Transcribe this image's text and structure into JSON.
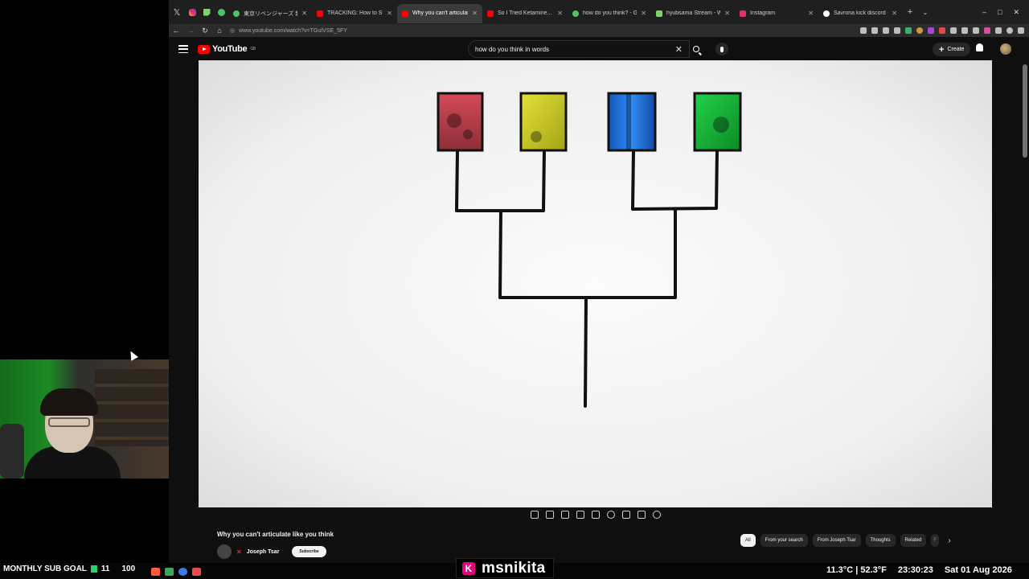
{
  "browser": {
    "tabs": [
      {
        "title": "東京リベンジャーズ 新衣装 ...",
        "color": "#4fc36a"
      },
      {
        "title": "TRACKING: How to Stick an I",
        "color": "#ff0000"
      },
      {
        "title": "Why you can't articulate like",
        "color": "#ff0000",
        "active": true
      },
      {
        "title": "So I Tried Ketamine... | Bryan",
        "color": "#ff0000"
      },
      {
        "title": "how do you think? - Google",
        "color": "#4fc36a"
      },
      {
        "title": "hyubsama Stream - Watch Li",
        "color": "#7bd36a"
      },
      {
        "title": "Instagram",
        "color": "#e1306c"
      },
      {
        "title": "Savrona kick discord - Goog",
        "color": "#ffffff"
      }
    ],
    "url": "www.youtube.com/watch?v=TGuIVSE_5FY",
    "window_controls": [
      "–",
      "□",
      "✕"
    ]
  },
  "youtube": {
    "logo": "YouTube",
    "region": "GB",
    "search_query": "how do you think in words",
    "create_label": "Create",
    "video_title": "Why you can't articulate like you think",
    "channel_name": "Joseph Tsar",
    "subscribe_label": "Subscribe",
    "chips": [
      "All",
      "From your search",
      "From Joseph Tsar",
      "Thoughts",
      "Related",
      "F"
    ],
    "selected_chip": "All"
  },
  "overlay": {
    "sub_goal_label": "MONTHLY SUB GOAL",
    "sub_current": "11",
    "sub_target": "100",
    "streamer_name": "msnikita",
    "temperature": "11.3°C | 52.3°F",
    "time": "23:30:23",
    "date": "Sat 01 Aug 2026"
  },
  "icons": {
    "search": "search-icon",
    "mic": "microphone-icon",
    "bell": "bell-icon",
    "menu": "hamburger-menu-icon"
  },
  "colors": {
    "yt_red": "#ff0000",
    "red_box": "#c84050",
    "yellow_box": "#d6d61e",
    "blue_box": "#1f6fd8",
    "green_box": "#1bc43a"
  }
}
